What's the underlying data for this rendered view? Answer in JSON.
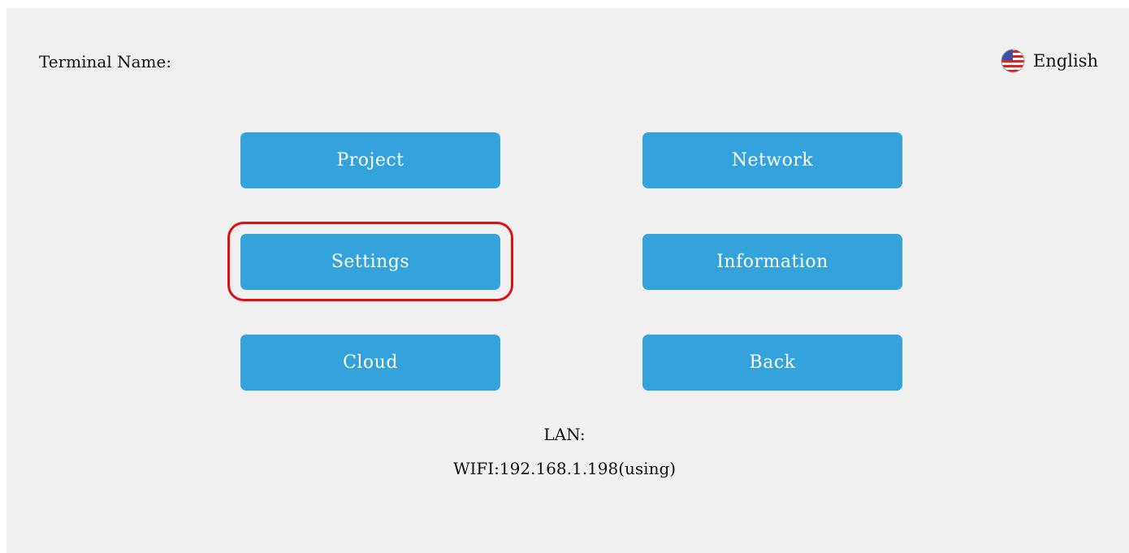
{
  "header": {
    "terminal_label": "Terminal Name:",
    "language": {
      "label": "English",
      "icon": "us-flag-icon"
    }
  },
  "menu": {
    "project": "Project",
    "network": "Network",
    "settings": "Settings",
    "information": "Information",
    "cloud": "Cloud",
    "back": "Back"
  },
  "status": {
    "lan": "LAN:",
    "wifi": "WIFI:192.168.1.198(using)"
  },
  "colors": {
    "button": "#34a3dc",
    "background": "#f0f0f0",
    "highlight": "#e01010"
  }
}
